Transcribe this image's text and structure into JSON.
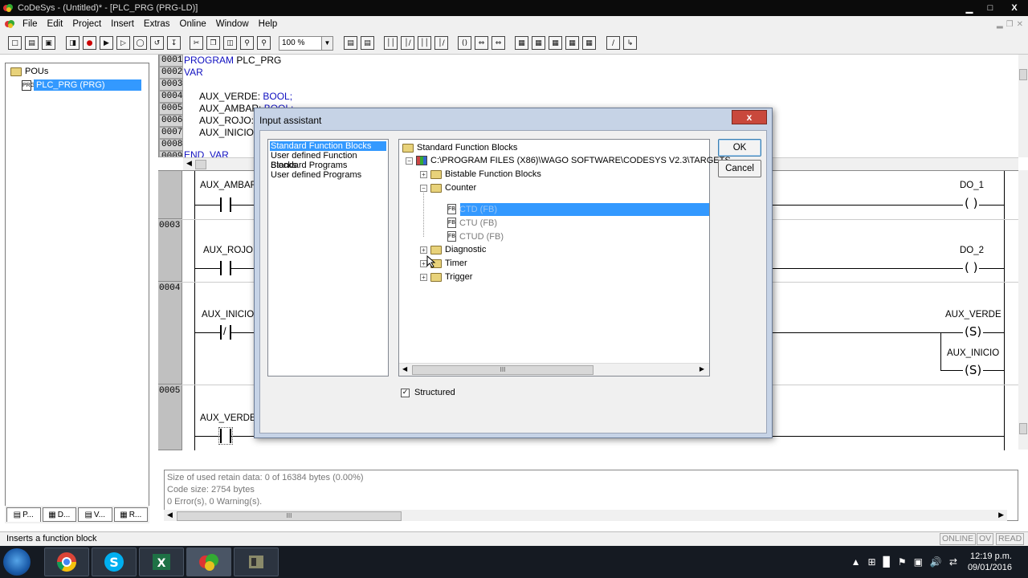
{
  "window": {
    "title": "CoDeSys - (Untitled)* - [PLC_PRG (PRG-LD)]",
    "minimize": "▁",
    "maximize": "□",
    "close": "X"
  },
  "menu": [
    "File",
    "Edit",
    "Project",
    "Insert",
    "Extras",
    "Online",
    "Window",
    "Help"
  ],
  "toolbar": {
    "zoom": "100 %"
  },
  "pou_tree": {
    "root": "POUs",
    "selected_item": "PLC_PRG (PRG)"
  },
  "left_tabs": [
    {
      "label": "P..."
    },
    {
      "label": "D..."
    },
    {
      "label": "V..."
    },
    {
      "label": "R..."
    }
  ],
  "declaration": {
    "line_numbers": [
      "0001",
      "0002",
      "0003",
      "0004",
      "0005",
      "0006",
      "0007",
      "0008",
      "0009"
    ],
    "lines": [
      {
        "kw": "PROGRAM",
        "text": " PLC_PRG"
      },
      {
        "kw": "VAR",
        "text": ""
      },
      {
        "kw": "",
        "text": ""
      },
      {
        "name": "AUX_VERDE:",
        "type": "BOOL;"
      },
      {
        "name": "AUX_AMBAR:",
        "type": "BOOL;"
      },
      {
        "name": "AUX_ROJO:",
        "type": ""
      },
      {
        "name": "AUX_INICIO:",
        "type": ""
      },
      {
        "kw": "",
        "text": ""
      },
      {
        "kw": "END_VAR",
        "text": ""
      }
    ]
  },
  "ladder": {
    "networks": [
      {
        "num": "",
        "contact": "AUX_AMBAR",
        "coil": "DO_1",
        "coil_symbol": "( )"
      },
      {
        "num": "0003",
        "contact": "AUX_ROJO",
        "coil": "DO_2",
        "coil_symbol": "( )"
      },
      {
        "num": "0004",
        "contact": "AUX_INICIO",
        "coil": "AUX_VERDE",
        "coil_symbol": "(S)",
        "coil2": "AUX_INICIO",
        "coil2_symbol": "(S)"
      },
      {
        "num": "0005",
        "contact": "AUX_VERDE",
        "coil": "",
        "coil_symbol": ""
      }
    ]
  },
  "messages": [
    "Size of used retain data: 0 of 16384 bytes (0.00%)",
    "Code size: 2754 bytes",
    "0 Error(s), 0 Warning(s)."
  ],
  "statusbar": {
    "text": "Inserts a function block",
    "online": "ONLINE",
    "ov": "OV",
    "read": "READ"
  },
  "dialog": {
    "title": "Input assistant",
    "close": "x",
    "categories": [
      "Standard Function Blocks",
      "User defined Function Blocks",
      "Standard Programs",
      "User defined Programs"
    ],
    "tree": {
      "root": "Standard Function Blocks",
      "library": "C:\\PROGRAM FILES (X86)\\WAGO SOFTWARE\\CODESYS V2.3\\TARGETS",
      "folders": [
        {
          "label": "Bistable Function Blocks",
          "exp": "+"
        },
        {
          "label": "Counter",
          "exp": "−"
        },
        {
          "label": "Diagnostic",
          "exp": "+"
        },
        {
          "label": "Timer",
          "exp": "+"
        },
        {
          "label": "Trigger",
          "exp": "+"
        }
      ],
      "counter_items": [
        "CTD (FB)",
        "CTU (FB)",
        "CTUD (FB)"
      ]
    },
    "ok": "OK",
    "cancel": "Cancel",
    "structured_label": "Structured",
    "structured_checked": "✓",
    "scroll_thumb": "III"
  },
  "taskbar": {
    "time": "12:19 p.m.",
    "date": "09/01/2016"
  }
}
